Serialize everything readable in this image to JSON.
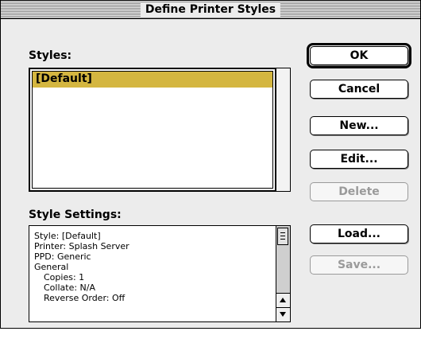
{
  "window": {
    "title": "Define Printer Styles"
  },
  "styles": {
    "label": "Styles:",
    "items": [
      "[Default]"
    ],
    "selected": "[Default]",
    "selection_color": "#d4b640"
  },
  "settings": {
    "label": "Style Settings:",
    "lines": [
      "Style: [Default]",
      "Printer: Splash Server",
      "PPD: Generic",
      "General",
      "Copies: 1",
      "Collate: N/A",
      "Reverse Order: Off"
    ]
  },
  "buttons": {
    "ok": "OK",
    "cancel": "Cancel",
    "new": "New...",
    "edit": "Edit...",
    "delete": "Delete",
    "load": "Load...",
    "save": "Save..."
  },
  "icons": [
    "scroll-up-arrow-icon",
    "scroll-down-arrow-icon",
    "scroll-thumb-grip-icon"
  ]
}
